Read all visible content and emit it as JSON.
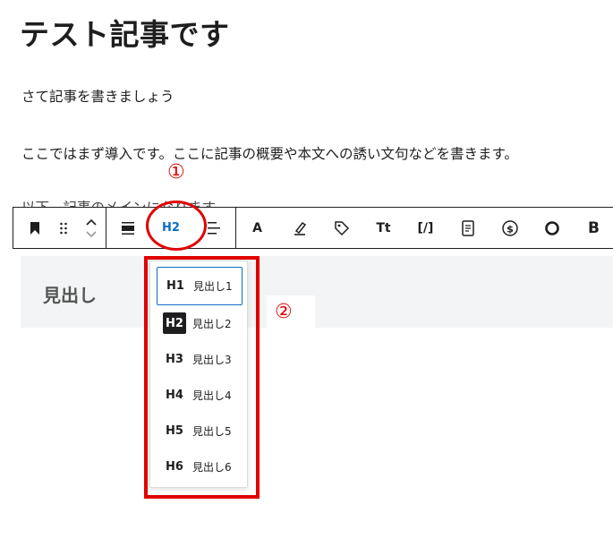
{
  "post": {
    "title": "テスト記事です",
    "paragraphs": [
      "さて記事を書きましょう",
      "ここではまず導入です。ここに記事の概要や本文への誘い文句などを書きます。",
      "以下、記事のメインになります"
    ]
  },
  "toolbar": {
    "current_level": "H2",
    "text_color_label": "A",
    "typography_label": "Tt",
    "shortcode_label": "[/]",
    "bold_label": "B"
  },
  "heading_block": {
    "text": "見出し"
  },
  "heading_dropdown": {
    "items": [
      {
        "tag": "H1",
        "label": "見出し1",
        "state": "focused"
      },
      {
        "tag": "H2",
        "label": "見出し2",
        "state": "selected"
      },
      {
        "tag": "H3",
        "label": "見出し3",
        "state": ""
      },
      {
        "tag": "H4",
        "label": "見出し4",
        "state": ""
      },
      {
        "tag": "H5",
        "label": "見出し5",
        "state": ""
      },
      {
        "tag": "H6",
        "label": "見出し6",
        "state": ""
      }
    ]
  },
  "annotations": {
    "marker_1": "①",
    "marker_2": "②",
    "color": "#e00000"
  },
  "colors": {
    "accent": "#0a6ec4",
    "text": "#1e1e1e"
  }
}
